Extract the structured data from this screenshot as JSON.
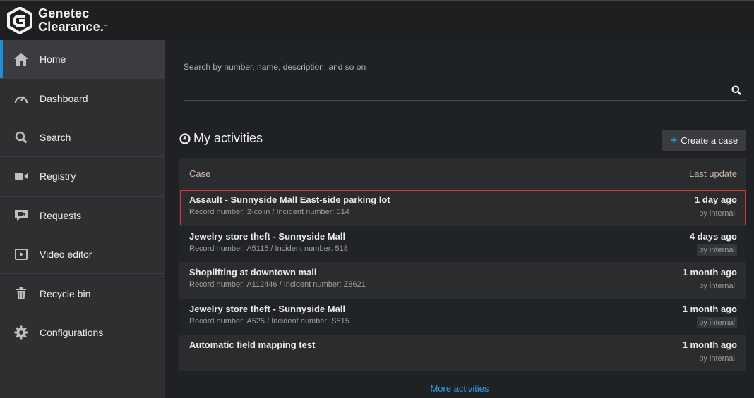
{
  "brand": {
    "line1": "Genetec",
    "line2": "Clearance.",
    "tm": "™"
  },
  "sidebar": {
    "items": [
      {
        "label": "Home",
        "icon": "home-icon",
        "active": true
      },
      {
        "label": "Dashboard",
        "icon": "gauge-icon"
      },
      {
        "label": "Search",
        "icon": "search-icon"
      },
      {
        "label": "Registry",
        "icon": "camera-icon"
      },
      {
        "label": "Requests",
        "icon": "request-icon"
      },
      {
        "label": "Video editor",
        "icon": "video-editor-icon"
      },
      {
        "label": "Recycle bin",
        "icon": "trash-icon"
      },
      {
        "label": "Configurations",
        "icon": "gear-icon"
      }
    ]
  },
  "search": {
    "placeholder": "Search by number, name, description, and so on"
  },
  "activities": {
    "title": "My activities",
    "create_label": "Create a case",
    "columns": {
      "case": "Case",
      "last_update": "Last update"
    },
    "rows": [
      {
        "title": "Assault - Sunnyside Mall East-side parking lot",
        "sub": "Record number: 2-colin / Incident number: 514",
        "when": "1 day ago",
        "by": "by internal",
        "selected": true
      },
      {
        "title": "Jewelry store theft - Sunnyside Mall",
        "sub": "Record number: A5115 / Incident number: 518",
        "when": "4 days ago",
        "by": "by internal"
      },
      {
        "title": "Shoplifting at downtown mall",
        "sub": "Record number: A112446 / Incident number: Z8621",
        "when": "1 month ago",
        "by": "by internal"
      },
      {
        "title": "Jewelry store theft - Sunnyside Mall",
        "sub": "Record number: A525 / Incident number: S515",
        "when": "1 month ago",
        "by": "by internal"
      },
      {
        "title": "Automatic field mapping test",
        "sub": "",
        "when": "1 month ago",
        "by": "by internal"
      }
    ],
    "more_label": "More activities"
  },
  "colors": {
    "accent": "#1b8fd8",
    "selected_border": "#d9373a",
    "link": "#2d9fe0"
  }
}
